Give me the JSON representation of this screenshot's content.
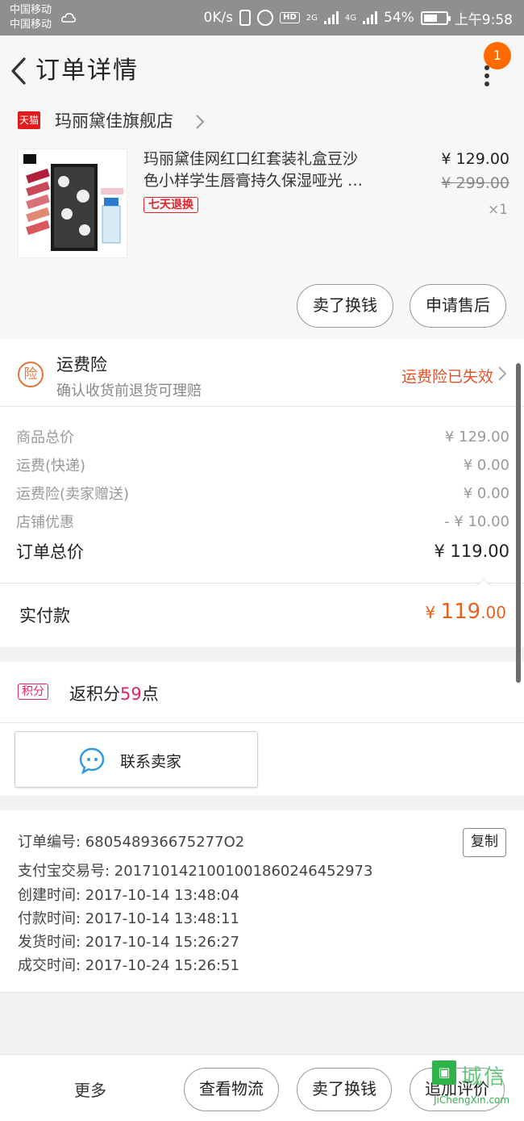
{
  "status_bar": {
    "carrier1": "中国移动",
    "carrier2": "中国移动",
    "speed": "0K/s",
    "hd": "HD",
    "net1": "2G",
    "net2": "4G",
    "battery_pct": "54%",
    "time": "上午9:58"
  },
  "header": {
    "title": "订单详情",
    "badge_count": "1"
  },
  "store": {
    "platform_badge": "天猫",
    "name": "玛丽黛佳旗舰店"
  },
  "product": {
    "title_line1": "玛丽黛佳网红口红套装礼盒豆沙",
    "title_line2": "色小样学生唇膏持久保湿哑光 …",
    "return_tag": "七天退换",
    "price": "¥ 129.00",
    "original_price": "¥ 299.00",
    "quantity": "×1",
    "btn_sell": "卖了换钱",
    "btn_aftersale": "申请售后"
  },
  "insurance": {
    "icon_text": "险",
    "title": "运费险",
    "subtitle": "确认收货前退货可理赔",
    "status": "运费险已失效"
  },
  "summary": {
    "rows": [
      {
        "label": "商品总价",
        "value": "¥ 129.00"
      },
      {
        "label": "运费(快递)",
        "value": "¥ 0.00"
      },
      {
        "label": "运费险(卖家赠送)",
        "value": "¥ 0.00"
      },
      {
        "label": "店铺优惠",
        "value": "- ¥ 10.00"
      }
    ],
    "total_label": "订单总价",
    "total_value": "¥ 119.00"
  },
  "payment": {
    "label": "实付款",
    "currency": "¥",
    "amount_int": "119",
    "amount_dec": ".00"
  },
  "points": {
    "badge": "积分",
    "text_prefix": "返积分",
    "number": "59",
    "text_suffix": "点"
  },
  "contact": {
    "label": "联系卖家"
  },
  "order_info": {
    "order_no": "订单编号: 680548936675277O2",
    "alipay_no": "支付宝交易号: 2017101421001001860246452973",
    "created": "创建时间: 2017-10-14 13:48:04",
    "paid": "付款时间: 2017-10-14 13:48:11",
    "shipped": "发货时间: 2017-10-14 15:26:27",
    "completed": "成交时间: 2017-10-24 15:26:51",
    "copy_label": "复制"
  },
  "bottom_bar": {
    "more": "更多",
    "logistics": "查看物流",
    "sell": "卖了换钱",
    "review": "追加评价"
  },
  "watermark": {
    "text": "城信",
    "url": "JiChengXin.com"
  },
  "colors": {
    "accent_orange": "#e8621c",
    "tmall_red": "#e01b1b",
    "points_pink": "#e0246a"
  }
}
